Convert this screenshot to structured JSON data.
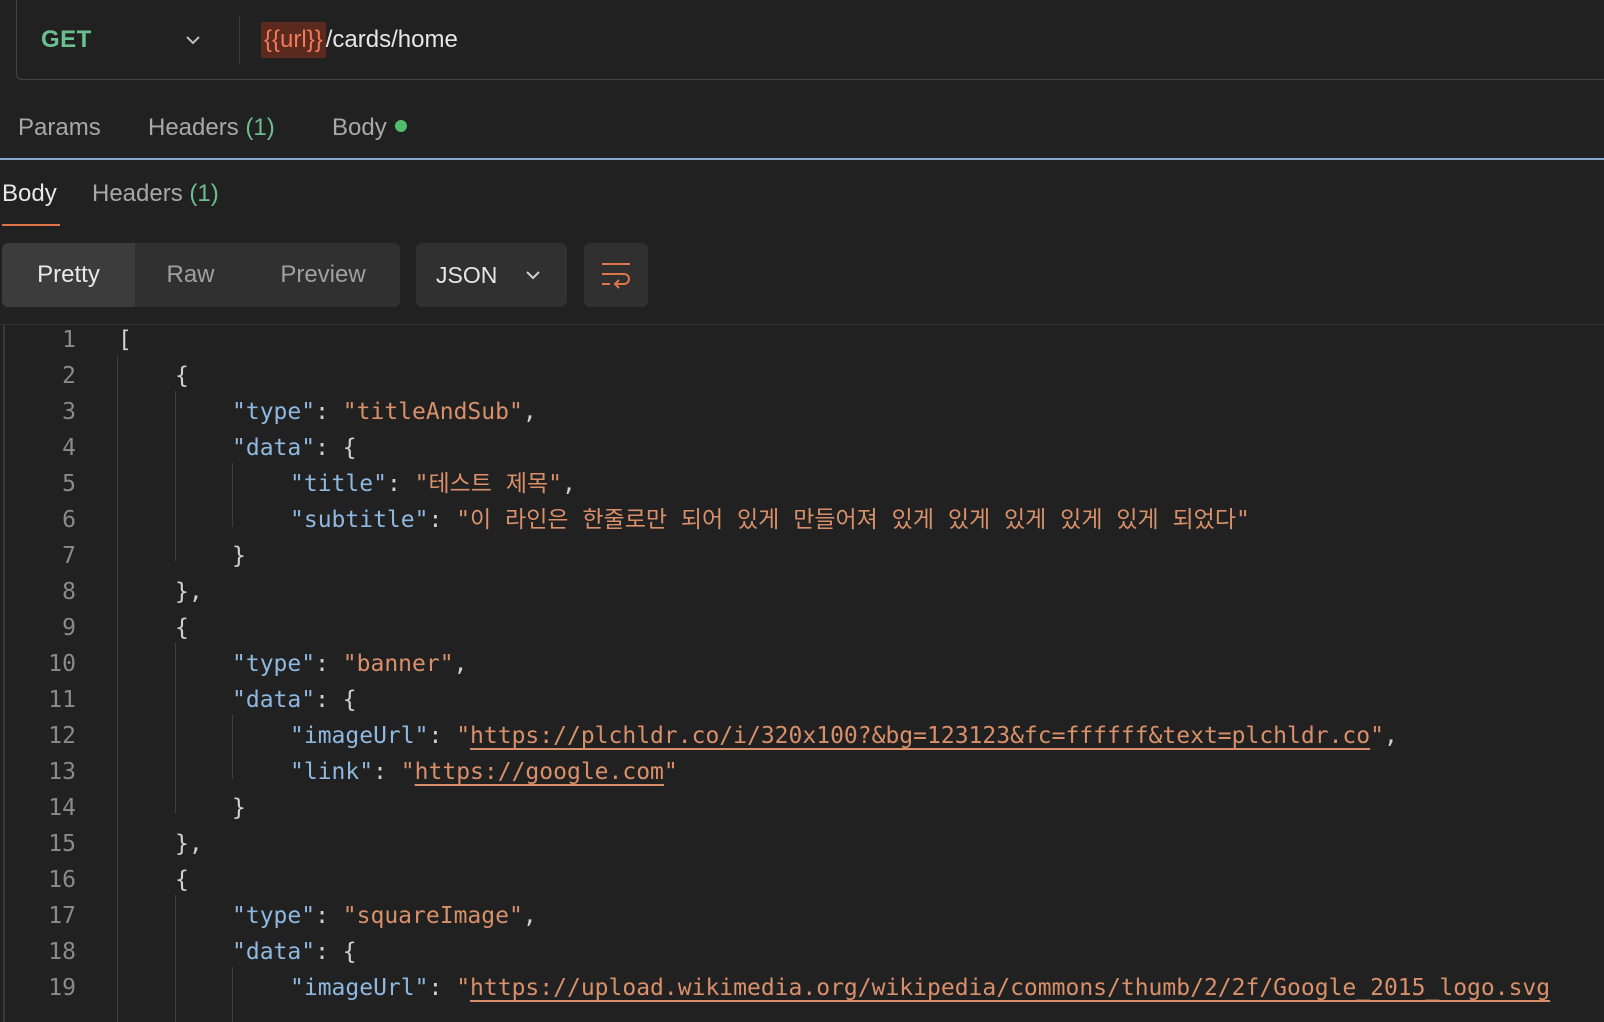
{
  "request": {
    "method": "GET",
    "url_variable": "{{url}}",
    "url_path": "/cards/home"
  },
  "request_tabs": {
    "params": "Params",
    "headers": "Headers",
    "headers_count": "(1)",
    "body": "Body"
  },
  "response_tabs": {
    "body": "Body",
    "headers": "Headers",
    "headers_count": "(1)"
  },
  "view_modes": {
    "pretty": "Pretty",
    "raw": "Raw",
    "preview": "Preview"
  },
  "format": "JSON",
  "colors": {
    "method_green": "#6bbf8f",
    "accent_orange": "#e0744a",
    "json_key": "#8fb8e0",
    "json_string": "#d9906a",
    "tab_divider": "#8aa6d0"
  },
  "icons": {
    "method_dropdown": "chevron-down-icon",
    "format_dropdown": "chevron-down-icon",
    "wrap": "text-wrap-icon",
    "body_status": "green-dot-icon"
  },
  "code": {
    "line_numbers": [
      "1",
      "2",
      "3",
      "4",
      "5",
      "6",
      "7",
      "8",
      "9",
      "10",
      "11",
      "12",
      "13",
      "14",
      "15",
      "16",
      "17",
      "18",
      "19"
    ],
    "l1": "[",
    "l2": "{",
    "l3_key": "\"type\"",
    "l3_val": "\"titleAndSub\"",
    "l4_key": "\"data\"",
    "l4_rest": ": {",
    "l5_key": "\"title\"",
    "l5_val": "\"테스트 제목\"",
    "l6_key": "\"subtitle\"",
    "l6_val": "\"이 라인은 한줄로만 되어 있게 만들어져 있게 있게 있게 있게 있게 되었다\"",
    "l7": "}",
    "l8": "},",
    "l9": "{",
    "l10_key": "\"type\"",
    "l10_val": "\"banner\"",
    "l11_key": "\"data\"",
    "l11_rest": ": {",
    "l12_key": "\"imageUrl\"",
    "l12_url": "https://plchldr.co/i/320x100?&bg=123123&fc=ffffff&text=plchldr.co",
    "l13_key": "\"link\"",
    "l13_url": "https://google.com",
    "l14": "}",
    "l15": "},",
    "l16": "{",
    "l17_key": "\"type\"",
    "l17_val": "\"squareImage\"",
    "l18_key": "\"data\"",
    "l18_rest": ": {",
    "l19_key": "\"imageUrl\"",
    "l19_url": "https://upload.wikimedia.org/wikipedia/commons/thumb/2/2f/Google_2015_logo.svg"
  }
}
